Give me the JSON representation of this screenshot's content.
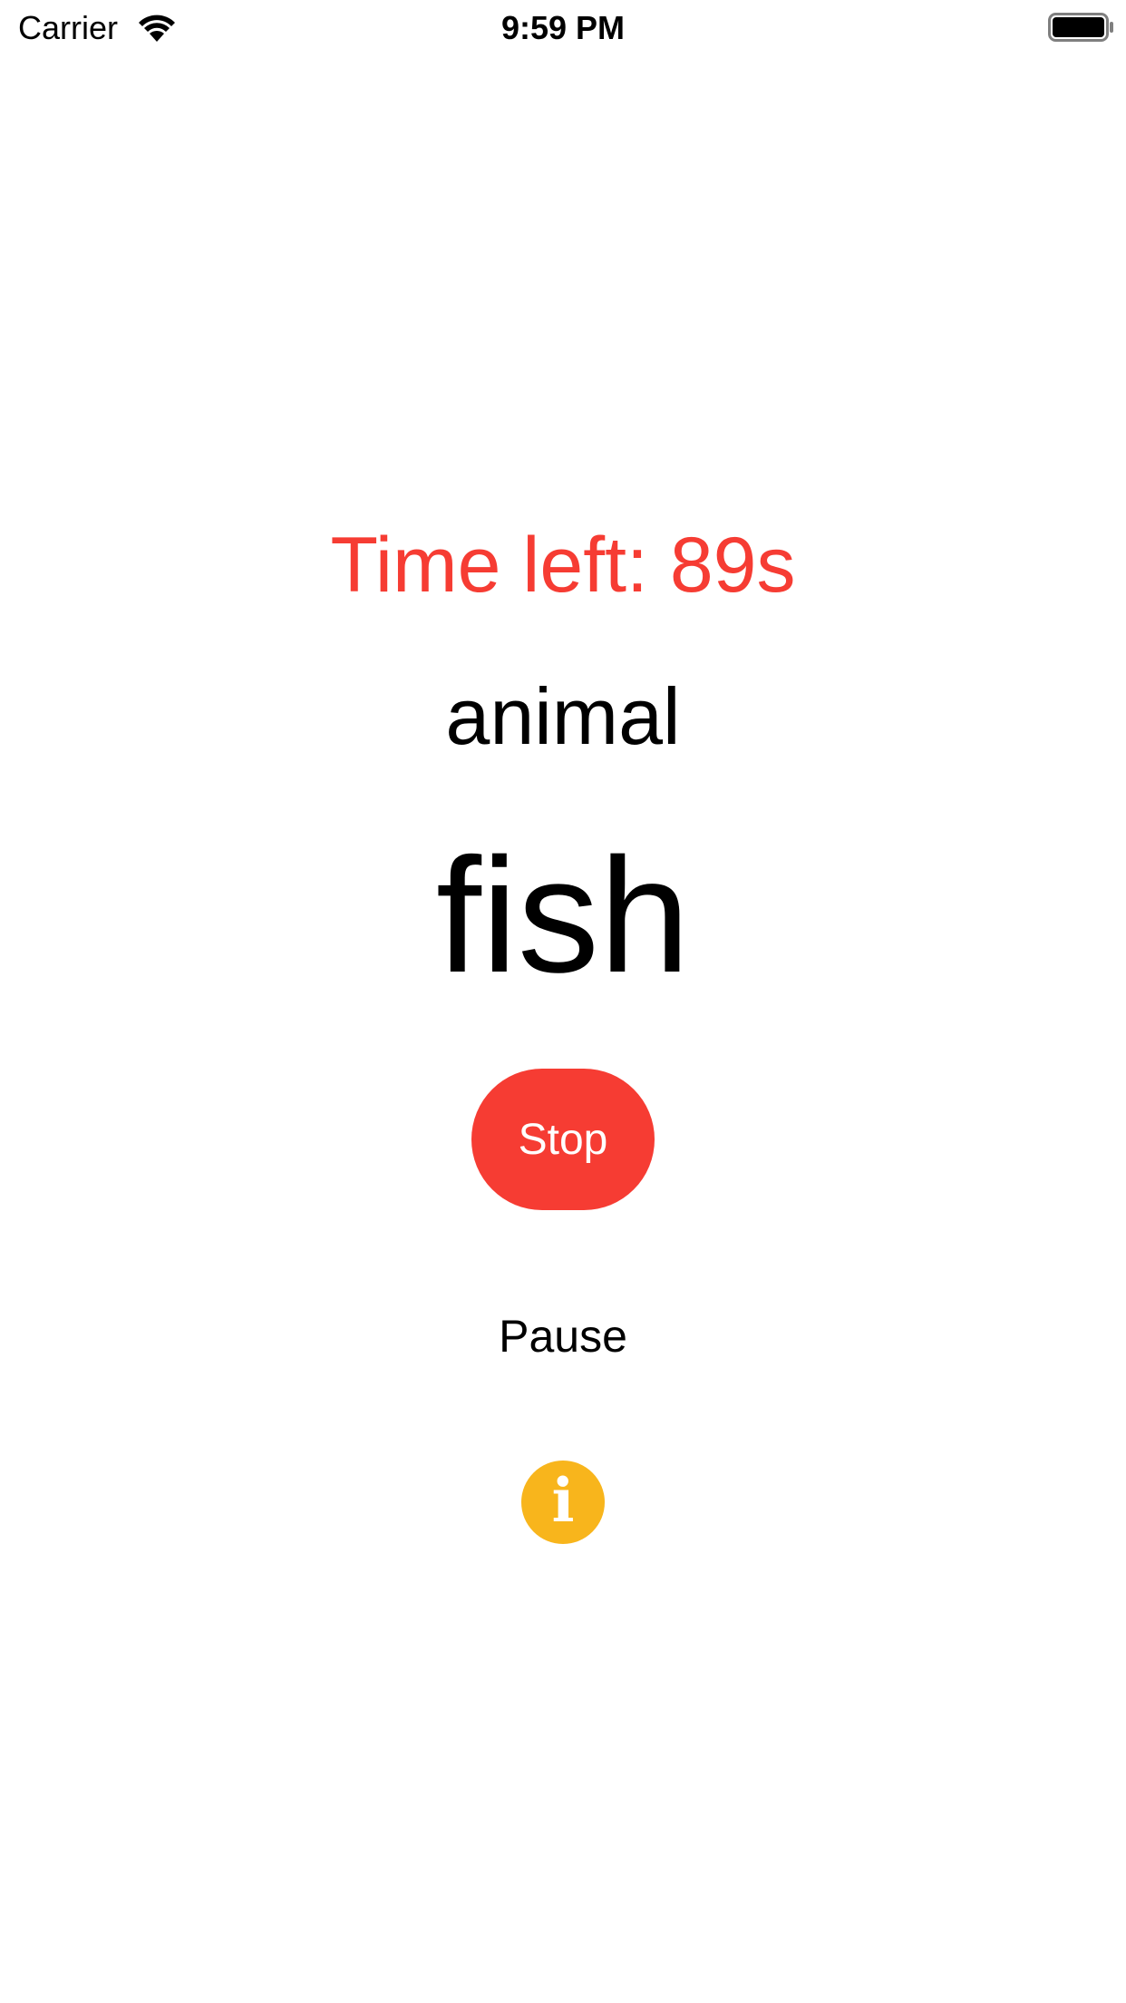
{
  "status_bar": {
    "carrier": "Carrier",
    "time": "9:59 PM",
    "wifi_icon": "wifi-icon",
    "battery_icon": "battery-icon"
  },
  "game": {
    "time_left": "Time left: 89s",
    "category": "animal",
    "word": "fish"
  },
  "controls": {
    "stop_label": "Stop",
    "pause_label": "Pause",
    "info_icon": "info-icon",
    "info_glyph": "i"
  },
  "colors": {
    "accent_red": "#f63c33",
    "info_yellow": "#f8b51c",
    "text": "#000000",
    "background": "#ffffff"
  }
}
